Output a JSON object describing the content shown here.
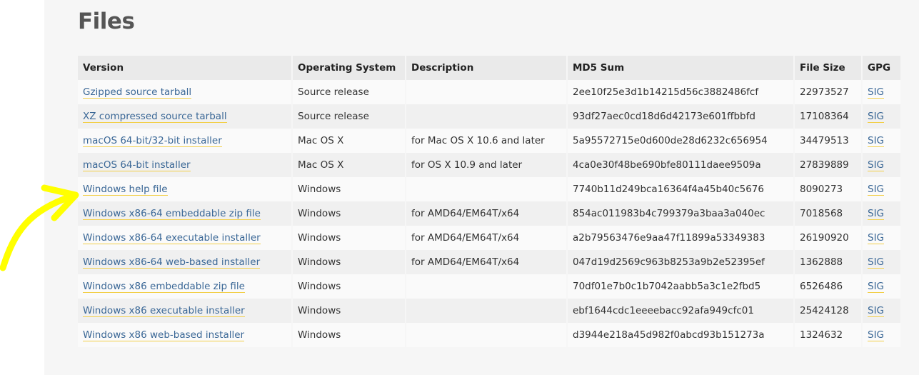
{
  "section_title": "Files",
  "headers": {
    "version": "Version",
    "os": "Operating System",
    "description": "Description",
    "md5": "MD5 Sum",
    "size": "File Size",
    "gpg": "GPG"
  },
  "rows": [
    {
      "version": "Gzipped source tarball",
      "os": "Source release",
      "description": "",
      "md5": "2ee10f25e3d1b14215d56c3882486fcf",
      "size": "22973527",
      "gpg": "SIG"
    },
    {
      "version": "XZ compressed source tarball",
      "os": "Source release",
      "description": "",
      "md5": "93df27aec0cd18d6d42173e601ffbbfd",
      "size": "17108364",
      "gpg": "SIG"
    },
    {
      "version": "macOS 64-bit/32-bit installer",
      "os": "Mac OS X",
      "description": "for Mac OS X 10.6 and later",
      "md5": "5a95572715e0d600de28d6232c656954",
      "size": "34479513",
      "gpg": "SIG"
    },
    {
      "version": "macOS 64-bit installer",
      "os": "Mac OS X",
      "description": "for OS X 10.9 and later",
      "md5": "4ca0e30f48be690bfe80111daee9509a",
      "size": "27839889",
      "gpg": "SIG"
    },
    {
      "version": "Windows help file",
      "os": "Windows",
      "description": "",
      "md5": "7740b11d249bca16364f4a45b40c5676",
      "size": "8090273",
      "gpg": "SIG"
    },
    {
      "version": "Windows x86-64 embeddable zip file",
      "os": "Windows",
      "description": "for AMD64/EM64T/x64",
      "md5": "854ac011983b4c799379a3baa3a040ec",
      "size": "7018568",
      "gpg": "SIG"
    },
    {
      "version": "Windows x86-64 executable installer",
      "os": "Windows",
      "description": "for AMD64/EM64T/x64",
      "md5": "a2b79563476e9aa47f11899a53349383",
      "size": "26190920",
      "gpg": "SIG"
    },
    {
      "version": "Windows x86-64 web-based installer",
      "os": "Windows",
      "description": "for AMD64/EM64T/x64",
      "md5": "047d19d2569c963b8253a9b2e52395ef",
      "size": "1362888",
      "gpg": "SIG"
    },
    {
      "version": "Windows x86 embeddable zip file",
      "os": "Windows",
      "description": "",
      "md5": "70df01e7b0c1b7042aabb5a3c1e2fbd5",
      "size": "6526486",
      "gpg": "SIG"
    },
    {
      "version": "Windows x86 executable installer",
      "os": "Windows",
      "description": "",
      "md5": "ebf1644cdc1eeeebacc92afa949cfc01",
      "size": "25424128",
      "gpg": "SIG"
    },
    {
      "version": "Windows x86 web-based installer",
      "os": "Windows",
      "description": "",
      "md5": "d3944e218a45d982f0abcd93b151273a",
      "size": "1324632",
      "gpg": "SIG"
    }
  ],
  "colors": {
    "link": "#3a6796",
    "link_underline": "#f2cf49",
    "annotation_arrow": "#ffff00"
  },
  "annotation": {
    "icon": "arrow-annotation-icon"
  }
}
